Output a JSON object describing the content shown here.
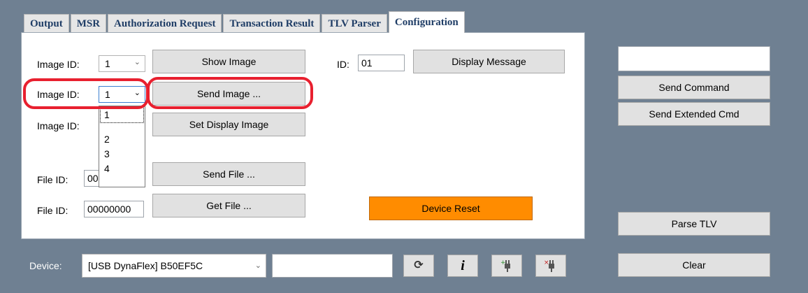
{
  "tabs": [
    "Output",
    "MSR",
    "Authorization Request",
    "Transaction Result",
    "TLV Parser",
    "Configuration"
  ],
  "config": {
    "image_id_label": "Image ID:",
    "image_id_1_value": "1",
    "image_id_2_value": "1",
    "show_image": "Show Image",
    "send_image": "Send Image ...",
    "set_display_image": "Set Display Image",
    "id_label": "ID:",
    "id_value": "01",
    "display_message": "Display Message",
    "file_id_label": "File ID:",
    "file_id_1_value": "00",
    "file_id_2_value": "00000000",
    "send_file": "Send File ...",
    "get_file": "Get File ...",
    "device_reset": "Device Reset",
    "dropdown_options": [
      "1",
      "2",
      "3",
      "4"
    ]
  },
  "right": {
    "command_input": "",
    "send_command": "Send Command",
    "send_extended": "Send Extended Cmd",
    "parse_tlv": "Parse TLV",
    "clear": "Clear"
  },
  "bottom": {
    "device_label": "Device:",
    "device_value": "[USB DynaFlex] B50EF5C",
    "status_input": ""
  },
  "colors": {
    "device_reset_bg": "#ff8c00",
    "highlight": "#e8202f",
    "tab_text": "#1f3d66"
  },
  "icons": [
    "refresh-icon",
    "info-icon",
    "connect-icon",
    "disconnect-icon"
  ]
}
